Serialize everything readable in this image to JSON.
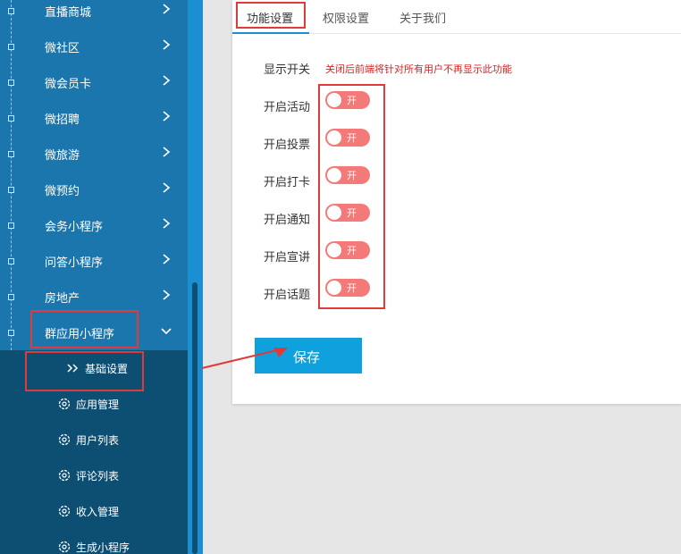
{
  "sidebar": {
    "items": [
      {
        "label": "直播商城"
      },
      {
        "label": "微社区"
      },
      {
        "label": "微会员卡"
      },
      {
        "label": "微招聘"
      },
      {
        "label": "微旅游"
      },
      {
        "label": "微预约"
      },
      {
        "label": "会务小程序"
      },
      {
        "label": "问答小程序"
      },
      {
        "label": "房地产"
      },
      {
        "label": "群应用小程序"
      }
    ],
    "submenu": [
      {
        "label": "基础设置",
        "icon": "double-chevron-right-icon",
        "active": true
      },
      {
        "label": "应用管理",
        "icon": "gear-icon"
      },
      {
        "label": "用户列表",
        "icon": "gear-icon"
      },
      {
        "label": "评论列表",
        "icon": "gear-icon"
      },
      {
        "label": "收入管理",
        "icon": "gear-icon"
      },
      {
        "label": "生成小程序",
        "icon": "gear-icon"
      }
    ]
  },
  "tabs": [
    {
      "label": "功能设置",
      "active": true
    },
    {
      "label": "权限设置"
    },
    {
      "label": "关于我们"
    }
  ],
  "form": {
    "display_switch_label": "显示开关",
    "display_switch_hint": "关闭后前端将针对所有用户不再显示此功能",
    "toggles": [
      {
        "label": "开启活动",
        "state": "开"
      },
      {
        "label": "开启投票",
        "state": "开"
      },
      {
        "label": "开启打卡",
        "state": "开"
      },
      {
        "label": "开启通知",
        "state": "开"
      },
      {
        "label": "开启宣讲",
        "state": "开"
      },
      {
        "label": "开启话题",
        "state": "开"
      }
    ],
    "save_label": "保存"
  },
  "colors": {
    "sidebar_bg": "#1a76ad",
    "submenu_bg": "#0d4f73",
    "accent": "#1a8fd1",
    "toggle_on": "#f47a7a",
    "save_button": "#0ea1dd",
    "annotation": "#e03a3a",
    "hint": "#e02020"
  }
}
